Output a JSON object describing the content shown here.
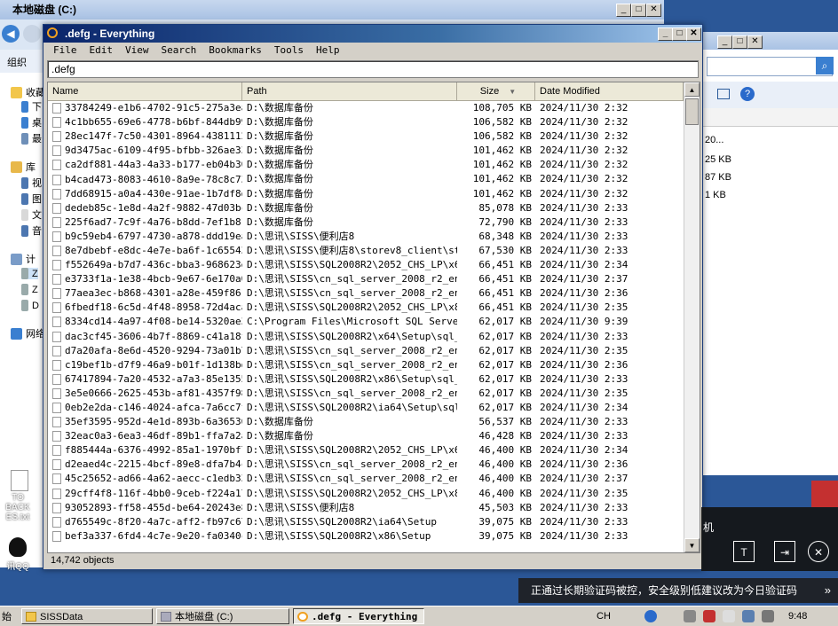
{
  "bg_window": {
    "title": "本地磁盘 (C:)",
    "toolbar_label": "组织",
    "nav_items": [
      "收藏",
      "下",
      "桌",
      "最",
      "库",
      "视",
      "图",
      "文",
      "音",
      "计",
      "Z",
      "Z",
      "D",
      "网络"
    ],
    "sizes": [
      "20...",
      "25 KB",
      "87 KB",
      "1 KB"
    ],
    "menu_label": "机"
  },
  "desktop": {
    "icons": [
      {
        "label": "TO BACK ES.txt"
      },
      {
        "label": "讯QQ"
      }
    ]
  },
  "everything": {
    "title": ".defg - Everything",
    "menu": [
      "File",
      "Edit",
      "View",
      "Search",
      "Bookmarks",
      "Tools",
      "Help"
    ],
    "search_value": ".defg",
    "columns": {
      "name": "Name",
      "path": "Path",
      "size": "Size",
      "date": "Date Modified"
    },
    "rows": [
      {
        "name": "33784249-e1b6-4702-91c5-275a3ea...",
        "path": "D:\\数据库备份",
        "size": "108,705 KB",
        "date": "2024/11/30 2:32"
      },
      {
        "name": "4c1bb655-69e6-4778-b6bf-844db99...",
        "path": "D:\\数据库备份",
        "size": "106,582 KB",
        "date": "2024/11/30 2:32"
      },
      {
        "name": "28ec147f-7c50-4301-8964-4381112...",
        "path": "D:\\数据库备份",
        "size": "106,582 KB",
        "date": "2024/11/30 2:32"
      },
      {
        "name": "9d3475ac-6109-4f95-bfbb-326ae33...",
        "path": "D:\\数据库备份",
        "size": "101,462 KB",
        "date": "2024/11/30 2:32"
      },
      {
        "name": "ca2df881-44a3-4a33-b177-eb04b30...",
        "path": "D:\\数据库备份",
        "size": "101,462 KB",
        "date": "2024/11/30 2:32"
      },
      {
        "name": "b4cad473-8083-4610-8a9e-78c8c73...",
        "path": "D:\\数据库备份",
        "size": "101,462 KB",
        "date": "2024/11/30 2:32"
      },
      {
        "name": "7dd68915-a0a4-430e-91ae-1b7df8d...",
        "path": "D:\\数据库备份",
        "size": "101,462 KB",
        "date": "2024/11/30 2:32"
      },
      {
        "name": "dedeb85c-1e8d-4a2f-9882-47d03bc...",
        "path": "D:\\数据库备份",
        "size": "85,078 KB",
        "date": "2024/11/30 2:33"
      },
      {
        "name": "225f6ad7-7c9f-4a76-b8dd-7ef1b81...",
        "path": "D:\\数据库备份",
        "size": "72,790 KB",
        "date": "2024/11/30 2:33"
      },
      {
        "name": "b9c59eb4-6797-4730-a878-ddd19ea...",
        "path": "D:\\思讯\\SISS\\便利店8",
        "size": "68,348 KB",
        "date": "2024/11/30 2:33"
      },
      {
        "name": "8e7dbebf-e8dc-4e7e-ba6f-1c65543...",
        "path": "D:\\思讯\\SISS\\便利店8\\storev8_client\\st...",
        "size": "67,530 KB",
        "date": "2024/11/30 2:33"
      },
      {
        "name": "f552649a-b7d7-436c-bba3-968623e...",
        "path": "D:\\思讯\\SISS\\SQL2008R2\\2052_CHS_LP\\x64...",
        "size": "66,451 KB",
        "date": "2024/11/30 2:34"
      },
      {
        "name": "e3733f1a-1e38-4bcb-9e67-6e170a0...",
        "path": "D:\\思讯\\SISS\\cn_sql_server_2008_r2_ent...",
        "size": "66,451 KB",
        "date": "2024/11/30 2:37"
      },
      {
        "name": "77aea3ec-b868-4301-a28e-459f861...",
        "path": "D:\\思讯\\SISS\\cn_sql_server_2008_r2_ent...",
        "size": "66,451 KB",
        "date": "2024/11/30 2:36"
      },
      {
        "name": "6fbedf18-6c5d-4f48-8958-72d4aca...",
        "path": "D:\\思讯\\SISS\\SQL2008R2\\2052_CHS_LP\\x86...",
        "size": "66,451 KB",
        "date": "2024/11/30 2:35"
      },
      {
        "name": "8334cd14-4a97-4f08-be14-5320ae3...",
        "path": "C:\\Program Files\\Microsoft SQL Server\\...",
        "size": "62,017 KB",
        "date": "2024/11/30 9:39"
      },
      {
        "name": "dac3cf45-3606-4b7f-8869-c41a18f...",
        "path": "D:\\思讯\\SISS\\SQL2008R2\\x64\\Setup\\sql_e...",
        "size": "62,017 KB",
        "date": "2024/11/30 2:33"
      },
      {
        "name": "d7a20afa-8e6d-4520-9294-73a01b7...",
        "path": "D:\\思讯\\SISS\\cn_sql_server_2008_r2_ent...",
        "size": "62,017 KB",
        "date": "2024/11/30 2:35"
      },
      {
        "name": "c19bef1b-d7f9-46a9-b01f-1d138bd...",
        "path": "D:\\思讯\\SISS\\cn_sql_server_2008_r2_ent...",
        "size": "62,017 KB",
        "date": "2024/11/30 2:36"
      },
      {
        "name": "67417894-7a20-4532-a7a3-85e1355...",
        "path": "D:\\思讯\\SISS\\SQL2008R2\\x86\\Setup\\sql_e...",
        "size": "62,017 KB",
        "date": "2024/11/30 2:33"
      },
      {
        "name": "3e5e0666-2625-453b-af81-4357f98...",
        "path": "D:\\思讯\\SISS\\cn_sql_server_2008_r2_ent...",
        "size": "62,017 KB",
        "date": "2024/11/30 2:35"
      },
      {
        "name": "0eb2e2da-c146-4024-afca-7a6cc7f...",
        "path": "D:\\思讯\\SISS\\SQL2008R2\\ia64\\Setup\\sql_...",
        "size": "62,017 KB",
        "date": "2024/11/30 2:34"
      },
      {
        "name": "35ef3595-952d-4e1d-893b-6a36536...",
        "path": "D:\\数据库备份",
        "size": "56,537 KB",
        "date": "2024/11/30 2:33"
      },
      {
        "name": "32eac0a3-6ea3-46df-89b1-ffa7a2a...",
        "path": "D:\\数据库备份",
        "size": "46,428 KB",
        "date": "2024/11/30 2:33"
      },
      {
        "name": "f885444a-6376-4992-85a1-1970bf7...",
        "path": "D:\\思讯\\SISS\\SQL2008R2\\2052_CHS_LP\\x64...",
        "size": "46,400 KB",
        "date": "2024/11/30 2:34"
      },
      {
        "name": "d2eaed4c-2215-4bcf-89e8-dfa7b4c...",
        "path": "D:\\思讯\\SISS\\cn_sql_server_2008_r2_ent...",
        "size": "46,400 KB",
        "date": "2024/11/30 2:36"
      },
      {
        "name": "45c25652-ad66-4a62-aecc-c1edb33...",
        "path": "D:\\思讯\\SISS\\cn_sql_server_2008_r2_ent...",
        "size": "46,400 KB",
        "date": "2024/11/30 2:37"
      },
      {
        "name": "29cff4f8-116f-4bb0-9ceb-f224a17...",
        "path": "D:\\思讯\\SISS\\SQL2008R2\\2052_CHS_LP\\x86...",
        "size": "46,400 KB",
        "date": "2024/11/30 2:35"
      },
      {
        "name": "93052893-ff58-455d-be64-20243e8...",
        "path": "D:\\思讯\\SISS\\便利店8",
        "size": "45,503 KB",
        "date": "2024/11/30 2:33"
      },
      {
        "name": "d765549c-8f20-4a7c-aff2-fb97c67...",
        "path": "D:\\思讯\\SISS\\SQL2008R2\\ia64\\Setup",
        "size": "39,075 KB",
        "date": "2024/11/30 2:33"
      },
      {
        "name": "bef3a337-6fd4-4c7e-9e20-fa0340c...",
        "path": "D:\\思讯\\SISS\\SQL2008R2\\x86\\Setup",
        "size": "39,075 KB",
        "date": "2024/11/30 2:33"
      }
    ],
    "status": "14,742 objects"
  },
  "taskbar": {
    "start_label": "始",
    "tasks": [
      "SISSData",
      "本地磁盘 (C:)",
      ".defg - Everything"
    ],
    "lang": "CH",
    "clock": "9:48"
  },
  "toast": {
    "text": "正通过长期验证码被控，安全级别低建议改为今日验证码"
  },
  "colors": {
    "titlebar_start": "#0a246a",
    "desktop": "#2b5797"
  }
}
